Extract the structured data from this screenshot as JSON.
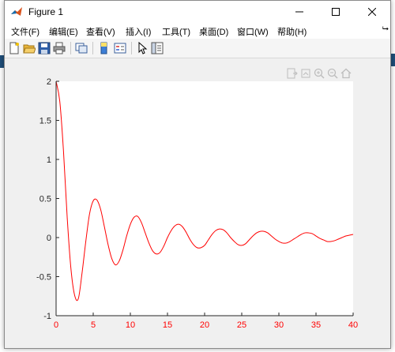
{
  "window": {
    "title": "Figure 1",
    "buttons": {
      "minimize": "minimize",
      "maximize": "maximize",
      "close": "close"
    }
  },
  "menu": {
    "items": [
      {
        "label": "文件(F)"
      },
      {
        "label": "编辑(E)"
      },
      {
        "label": "查看(V)"
      },
      {
        "label": "插入(I)"
      },
      {
        "label": "工具(T)"
      },
      {
        "label": "桌面(D)"
      },
      {
        "label": "窗口(W)"
      },
      {
        "label": "帮助(H)"
      }
    ],
    "overflow_icon": "chevron-right-icon"
  },
  "toolbar": {
    "tools": [
      "new-figure-icon",
      "open-file-icon",
      "save-icon",
      "print-icon",
      "link-plot-icon",
      "colorbar-icon",
      "legend-icon",
      "pointer-icon",
      "property-inspector-icon"
    ]
  },
  "axes_toolbar": {
    "tools": [
      "export-icon",
      "brush-icon",
      "zoom-in-icon",
      "zoom-out-icon",
      "home-icon"
    ]
  },
  "chart_data": {
    "type": "line",
    "title": "",
    "xlabel": "",
    "ylabel": "",
    "xlim": [
      0,
      40
    ],
    "ylim": [
      -1,
      2
    ],
    "xticks": [
      "0",
      "5",
      "10",
      "15",
      "20",
      "25",
      "30",
      "35",
      "40"
    ],
    "yticks": [
      "-1",
      "-0.5",
      "0",
      "0.5",
      "1",
      "1.5",
      "2"
    ],
    "grid": false,
    "series": [
      {
        "color": "#ff0000",
        "x": [
          0,
          0.5,
          1,
          1.5,
          2,
          2.5,
          3,
          3.5,
          4,
          4.5,
          5,
          5.5,
          6,
          6.5,
          7,
          7.5,
          8,
          8.5,
          9,
          9.5,
          10,
          10.5,
          11,
          11.5,
          12,
          12.5,
          13,
          13.5,
          14,
          14.5,
          15,
          15.5,
          16,
          16.5,
          17,
          17.5,
          18,
          18.5,
          19,
          19.5,
          20,
          20.5,
          21,
          21.5,
          22,
          22.5,
          23,
          23.5,
          24,
          24.5,
          25,
          25.5,
          26,
          26.5,
          27,
          27.5,
          28,
          28.5,
          29,
          29.5,
          30,
          30.5,
          31,
          31.5,
          32,
          32.5,
          33,
          33.5,
          34,
          34.5,
          35,
          35.5,
          36,
          36.5,
          37,
          37.5,
          38,
          38.5,
          39,
          39.5,
          40
        ],
        "y": [
          2,
          1.74,
          1.1,
          0.25,
          -0.4,
          -0.74,
          -0.78,
          -0.45,
          -0.05,
          0.3,
          0.47,
          0.48,
          0.36,
          0.14,
          -0.09,
          -0.27,
          -0.35,
          -0.3,
          -0.16,
          0.02,
          0.17,
          0.26,
          0.27,
          0.19,
          0.06,
          -0.07,
          -0.17,
          -0.21,
          -0.19,
          -0.11,
          0.0,
          0.09,
          0.15,
          0.17,
          0.14,
          0.07,
          -0.02,
          -0.09,
          -0.13,
          -0.13,
          -0.1,
          -0.03,
          0.04,
          0.09,
          0.11,
          0.1,
          0.06,
          0.0,
          -0.05,
          -0.09,
          -0.1,
          -0.08,
          -0.03,
          0.02,
          0.06,
          0.08,
          0.08,
          0.06,
          0.02,
          -0.02,
          -0.05,
          -0.07,
          -0.07,
          -0.05,
          -0.02,
          0.01,
          0.04,
          0.06,
          0.06,
          0.05,
          0.02,
          -0.01,
          -0.03,
          -0.05,
          -0.05,
          -0.04,
          -0.02,
          0.0,
          0.02,
          0.03,
          0.04
        ]
      }
    ]
  }
}
